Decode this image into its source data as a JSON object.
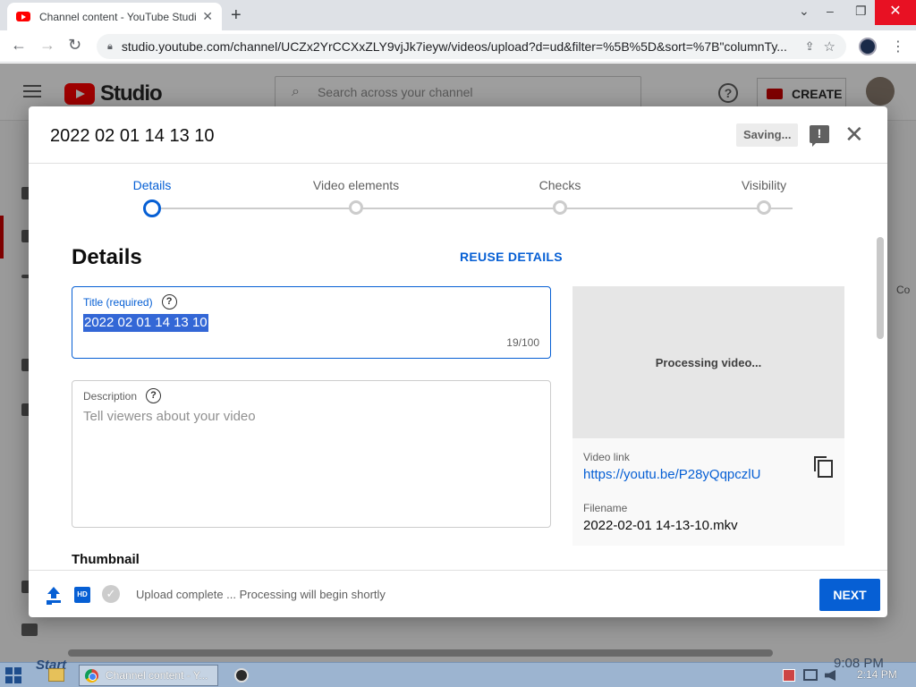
{
  "browser": {
    "tab_title": "Channel content - YouTube Studi",
    "tab_close": "✕",
    "new_tab": "+",
    "url": "studio.youtube.com/channel/UCZx2YrCCXxZLY9vjJk7ieyw/videos/upload?d=ud&filter=%5B%5D&sort=%7B\"columnTy..."
  },
  "studio": {
    "logo_text": "Studio",
    "search_placeholder": "Search across your channel",
    "help_glyph": "?",
    "create_label": "CREATE",
    "bg_right_text": "Co"
  },
  "dialog": {
    "title": "2022 02 01 14 13 10",
    "saving_label": "Saving...",
    "close_glyph": "✕",
    "steps": [
      {
        "label": "Details",
        "active": true
      },
      {
        "label": "Video elements",
        "active": false
      },
      {
        "label": "Checks",
        "active": false
      },
      {
        "label": "Visibility",
        "active": false
      }
    ],
    "section_title": "Details",
    "reuse_label": "REUSE DETAILS",
    "title_field": {
      "label": "Title (required)",
      "help": "?",
      "value": "2022 02 01 14 13 10",
      "counter": "19/100"
    },
    "description_field": {
      "label": "Description",
      "help": "?",
      "placeholder": "Tell viewers about your video"
    },
    "thumbnail_title": "Thumbnail",
    "preview": {
      "status": "Processing video...",
      "video_link_label": "Video link",
      "video_link": "https://youtu.be/P28yQqpczlU",
      "filename_label": "Filename",
      "filename": "2022-02-01 14-13-10.mkv"
    },
    "footer": {
      "hd_glyph": "HD",
      "check_glyph": "✓",
      "status": "Upload complete ... Processing will begin shortly",
      "next_label": "NEXT"
    }
  },
  "taskbar": {
    "start_ghost": "Start",
    "chrome_task": "Channel content - Y...",
    "tray_ghost_time": "9:08 PM",
    "clock": "2:14 PM"
  },
  "colors": {
    "accent": "#065fd4",
    "brand_red": "#ff0000",
    "close_red": "#e81123"
  }
}
